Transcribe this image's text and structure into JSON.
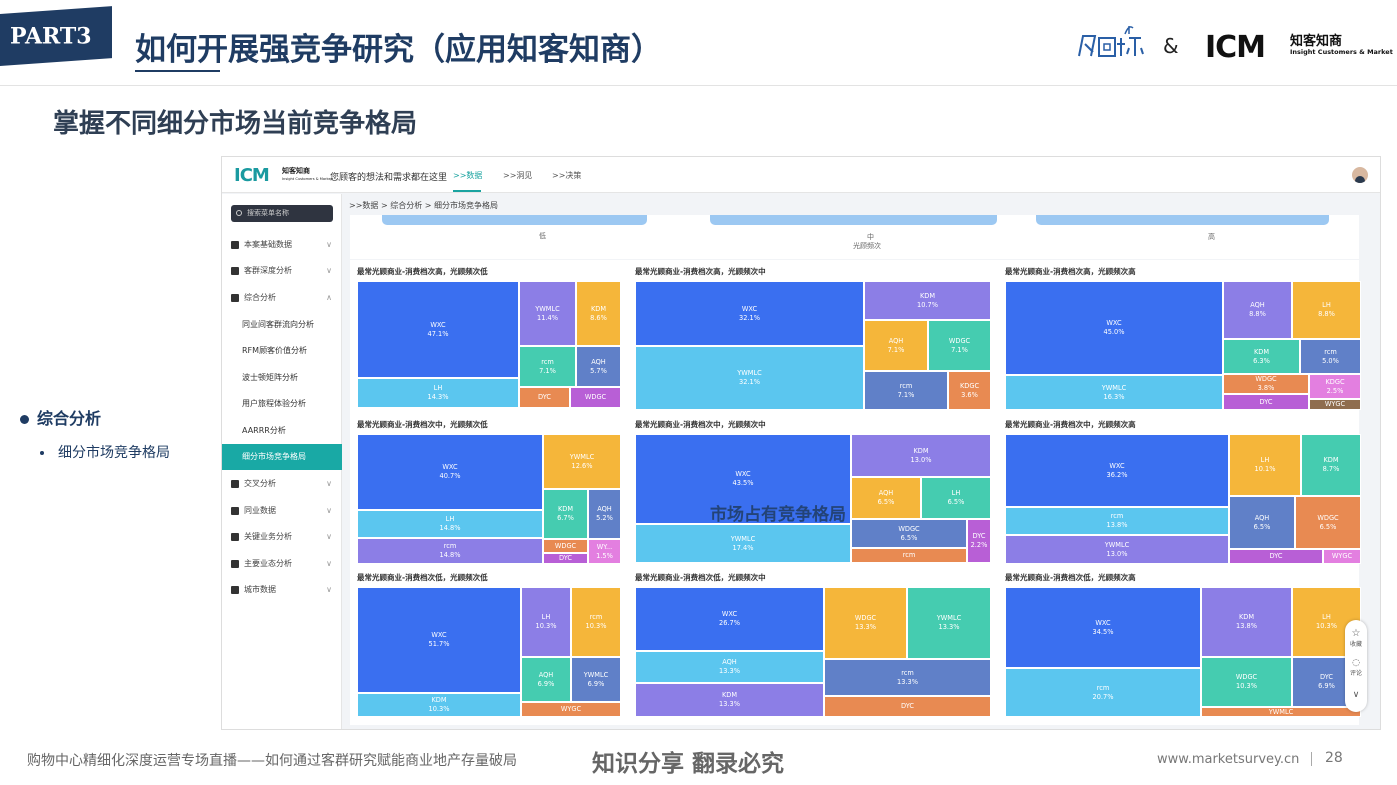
{
  "slide": {
    "part_tag": "PART3",
    "title": "如何开展强竞争研究（应用知客知商）",
    "subtitle": "掌握不同细分市场当前竞争格局",
    "amp": "&",
    "icm_logo": "ICM",
    "icm_cn": "知客知商",
    "icm_en": "Insight Customers & Market",
    "bullet": "综合分析",
    "sub_bullet": "细分市场竞争格局",
    "watermark": "市场占有竞争格局",
    "footer_left": "购物中心精细化深度运营专场直播——如何通过客群研究赋能商业地产存量破局",
    "footer_mid": "知识分享 翻录必究",
    "footer_url": "www.marketsurvey.cn",
    "footer_page": "28",
    "colors": {
      "brand": "#1f3c63",
      "teal": "#19a9a5"
    }
  },
  "app": {
    "logo": "ICM",
    "logo_cn": "知客知商",
    "logo_en": "Insight Customers & Market",
    "slogan": "您顾客的想法和需求都在这里",
    "nav": [
      ">>数据",
      ">>洞见",
      ">>决策"
    ],
    "search_placeholder": "搜索菜单名称",
    "menu": [
      {
        "label": "本案基础数据",
        "icon": "user-icon",
        "chevron": "∨"
      },
      {
        "label": "客群深度分析",
        "icon": "bar-chart-icon",
        "chevron": "∨"
      },
      {
        "label": "综合分析",
        "icon": "search-icon",
        "chevron": "∧"
      },
      {
        "label": "同业间客群流向分析"
      },
      {
        "label": "RFM顾客价值分析"
      },
      {
        "label": "波士顿矩阵分析"
      },
      {
        "label": "用户旅程体验分析"
      },
      {
        "label": "AARRR分析"
      },
      {
        "label": "细分市场竞争格局"
      },
      {
        "label": "交叉分析",
        "icon": "chart-icon",
        "chevron": "∨"
      },
      {
        "label": "同业数据",
        "icon": "group-icon",
        "chevron": "∨"
      },
      {
        "label": "关键业务分析",
        "icon": "bookmark-icon",
        "chevron": "∨"
      },
      {
        "label": "主要业态分析",
        "icon": "flag-icon",
        "chevron": "∨"
      },
      {
        "label": "城市数据",
        "icon": "building-icon",
        "chevron": "∨"
      }
    ],
    "breadcrumb": ">>数据  >  综合分析  >  细分市场竞争格局",
    "filter": {
      "low": "低",
      "mid": "中",
      "high": "高",
      "axis": "光顾频次"
    },
    "tools": [
      "收藏",
      "评论"
    ]
  },
  "chart_data": [
    {
      "type": "treemap",
      "title": "最常光顾商业-消费档次高，光顾频次低",
      "labels": [
        "WXC",
        "LH",
        "YWMLC",
        "KDM",
        "rcm",
        "AQH",
        "DYC",
        "WDGC"
      ],
      "values": [
        47.1,
        14.3,
        11.4,
        8.6,
        7.1,
        5.7,
        null,
        null
      ]
    },
    {
      "type": "treemap",
      "title": "最常光顾商业-消费档次高，光顾频次中",
      "labels": [
        "WXC",
        "YWMLC",
        "KDM",
        "AQH",
        "WDGC",
        "rcm",
        "KDGC"
      ],
      "values": [
        32.1,
        32.1,
        10.7,
        7.1,
        7.1,
        7.1,
        3.6
      ]
    },
    {
      "type": "treemap",
      "title": "最常光顾商业-消费档次高，光顾频次高",
      "labels": [
        "WXC",
        "YWMLC",
        "AQH",
        "LH",
        "KDM",
        "rcm",
        "WDGC",
        "KDGC",
        "DYC",
        "WYGC"
      ],
      "values": [
        45.0,
        16.3,
        8.8,
        8.8,
        6.3,
        5.0,
        3.8,
        2.5,
        null,
        null
      ]
    },
    {
      "type": "treemap",
      "title": "最常光顾商业-消费档次中，光顾频次低",
      "labels": [
        "WXC",
        "LH",
        "rcm",
        "YWMLC",
        "KDM",
        "AQH",
        "WDGC",
        "WY...",
        "DYC"
      ],
      "values": [
        40.7,
        14.8,
        14.8,
        12.6,
        6.7,
        5.2,
        null,
        1.5,
        null
      ]
    },
    {
      "type": "treemap",
      "title": "最常光顾商业-消费档次中，光顾频次中",
      "labels": [
        "WXC",
        "YWMLC",
        "KDM",
        "AQH",
        "LH",
        "WDGC",
        "rcm",
        "DYC"
      ],
      "values": [
        43.5,
        17.4,
        13.0,
        6.5,
        6.5,
        6.5,
        null,
        2.2
      ]
    },
    {
      "type": "treemap",
      "title": "最常光顾商业-消费档次中，光顾频次高",
      "labels": [
        "WXC",
        "rcm",
        "YWMLC",
        "LH",
        "KDM",
        "AQH",
        "WDGC",
        "DYC",
        "WYGC"
      ],
      "values": [
        36.2,
        13.8,
        13.0,
        10.1,
        8.7,
        6.5,
        6.5,
        null,
        null
      ]
    },
    {
      "type": "treemap",
      "title": "最常光顾商业-消费档次低，光顾频次低",
      "labels": [
        "WXC",
        "KDM",
        "LH",
        "rcm",
        "AQH",
        "YWMLC",
        "WYGC"
      ],
      "values": [
        51.7,
        10.3,
        10.3,
        10.3,
        6.9,
        6.9,
        null
      ]
    },
    {
      "type": "treemap",
      "title": "最常光顾商业-消费档次低，光顾频次中",
      "labels": [
        "WXC",
        "AQH",
        "KDM",
        "WDGC",
        "YWMLC",
        "rcm",
        "DYC"
      ],
      "values": [
        26.7,
        13.3,
        13.3,
        13.3,
        13.3,
        13.3,
        null
      ]
    },
    {
      "type": "treemap",
      "title": "最常光顾商业-消费档次低，光顾频次高",
      "labels": [
        "WXC",
        "rcm",
        "KDM",
        "LH",
        "WDGC",
        "DYC",
        "YWMLC"
      ],
      "values": [
        34.5,
        20.7,
        13.8,
        10.3,
        10.3,
        6.9,
        null
      ]
    }
  ],
  "palette": {
    "WXC": "#3a6ff0",
    "LH": "#5bc6ef",
    "rcm_a": "#4bcfb0",
    "YWMLC": "#8c7ee6",
    "KDM": "#8c7ee6",
    "AQH": "#6080c8",
    "DYC": "#e88a52",
    "WDGC": "#b85fd6",
    "yellow": "#f5b63a",
    "teal": "#45ccb0",
    "pink": "#e37fe0",
    "brown": "#8f6d4e"
  }
}
